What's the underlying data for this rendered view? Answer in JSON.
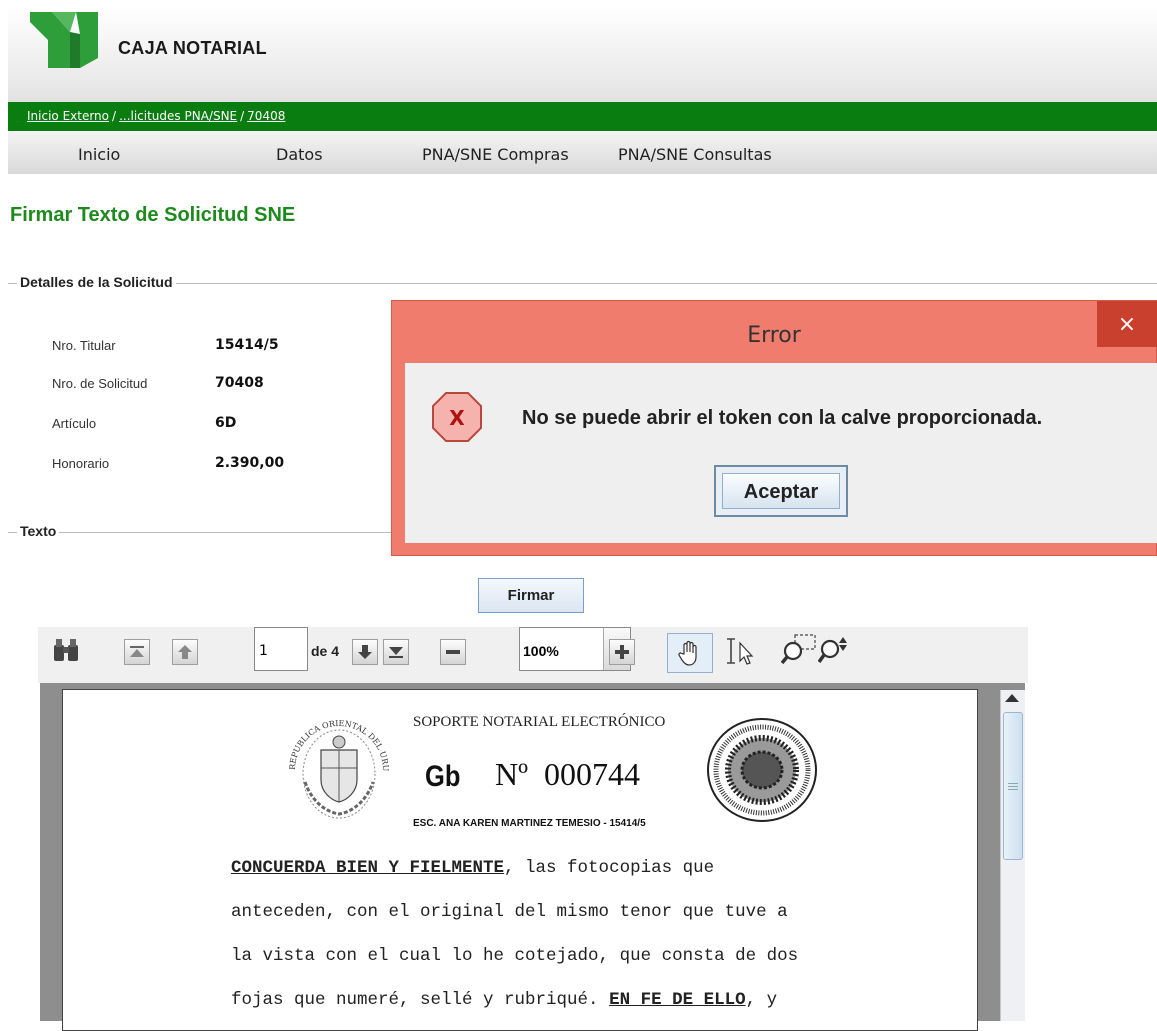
{
  "header": {
    "brand": "CAJA NOTARIAL"
  },
  "breadcrumb": [
    {
      "label": "Inicio Externo"
    },
    {
      "label": "...licitudes PNA/SNE"
    },
    {
      "label": "70408"
    }
  ],
  "menu": [
    "Inicio",
    "Datos",
    "PNA/SNE Compras",
    "PNA/SNE Consultas"
  ],
  "page_title": "Firmar Texto de Solicitud SNE",
  "details": {
    "legend": "Detalles de la Solicitud",
    "rows": [
      {
        "label": "Nro. Titular",
        "value": "15414/5"
      },
      {
        "label": "Nro. de Solicitud",
        "value": "70408"
      },
      {
        "label": "Artículo",
        "value": "6D"
      },
      {
        "label": "Honorario",
        "value": "2.390,00"
      }
    ]
  },
  "texto_legend": "Texto",
  "firmar_label": "Firmar",
  "pdf_toolbar": {
    "page_current": "1",
    "page_total": "de 4",
    "zoom": "100%",
    "icons": [
      "binoculars-icon",
      "first-page-icon",
      "previous-page-icon",
      "next-page-icon",
      "last-page-icon",
      "zoom-out-icon",
      "zoom-in-icon",
      "hand-tool-icon",
      "text-select-icon",
      "marquee-zoom-icon",
      "dynamic-zoom-icon"
    ]
  },
  "document": {
    "header": "SOPORTE NOTARIAL ELECTRÓNICO",
    "series": "Gb",
    "number": "Nº  000744",
    "notary": "ESC. ANA KAREN MARTINEZ TEMESIO - 15414/5",
    "seal_text": "REPUBLICA ORIENTAL DEL URUGUAY",
    "lines": [
      {
        "bold": "CONCUERDA  BIEN  Y  FIELMENTE",
        "text": ",  las  fotocopias  que"
      },
      {
        "bold": "",
        "text": "anteceden, con el original del mismo tenor que tuve a"
      },
      {
        "bold": "",
        "text": "la vista con el cual lo he cotejado, que consta de dos"
      },
      {
        "bold": "",
        "text": "fojas que numeré, sellé y rubriqué. ",
        "bold2": "EN FE DE ELLO",
        "text2": ", y"
      }
    ]
  },
  "dialog": {
    "title": "Error",
    "close": "×",
    "message": "No se puede abrir el token con la calve proporcionada.",
    "icon_text": "X",
    "button": "Aceptar"
  },
  "colors": {
    "brand_green": "#0a7d10",
    "title_green": "#1e8a1e",
    "dialog_frame": "#f07c6e",
    "close_button": "#c9402f"
  }
}
